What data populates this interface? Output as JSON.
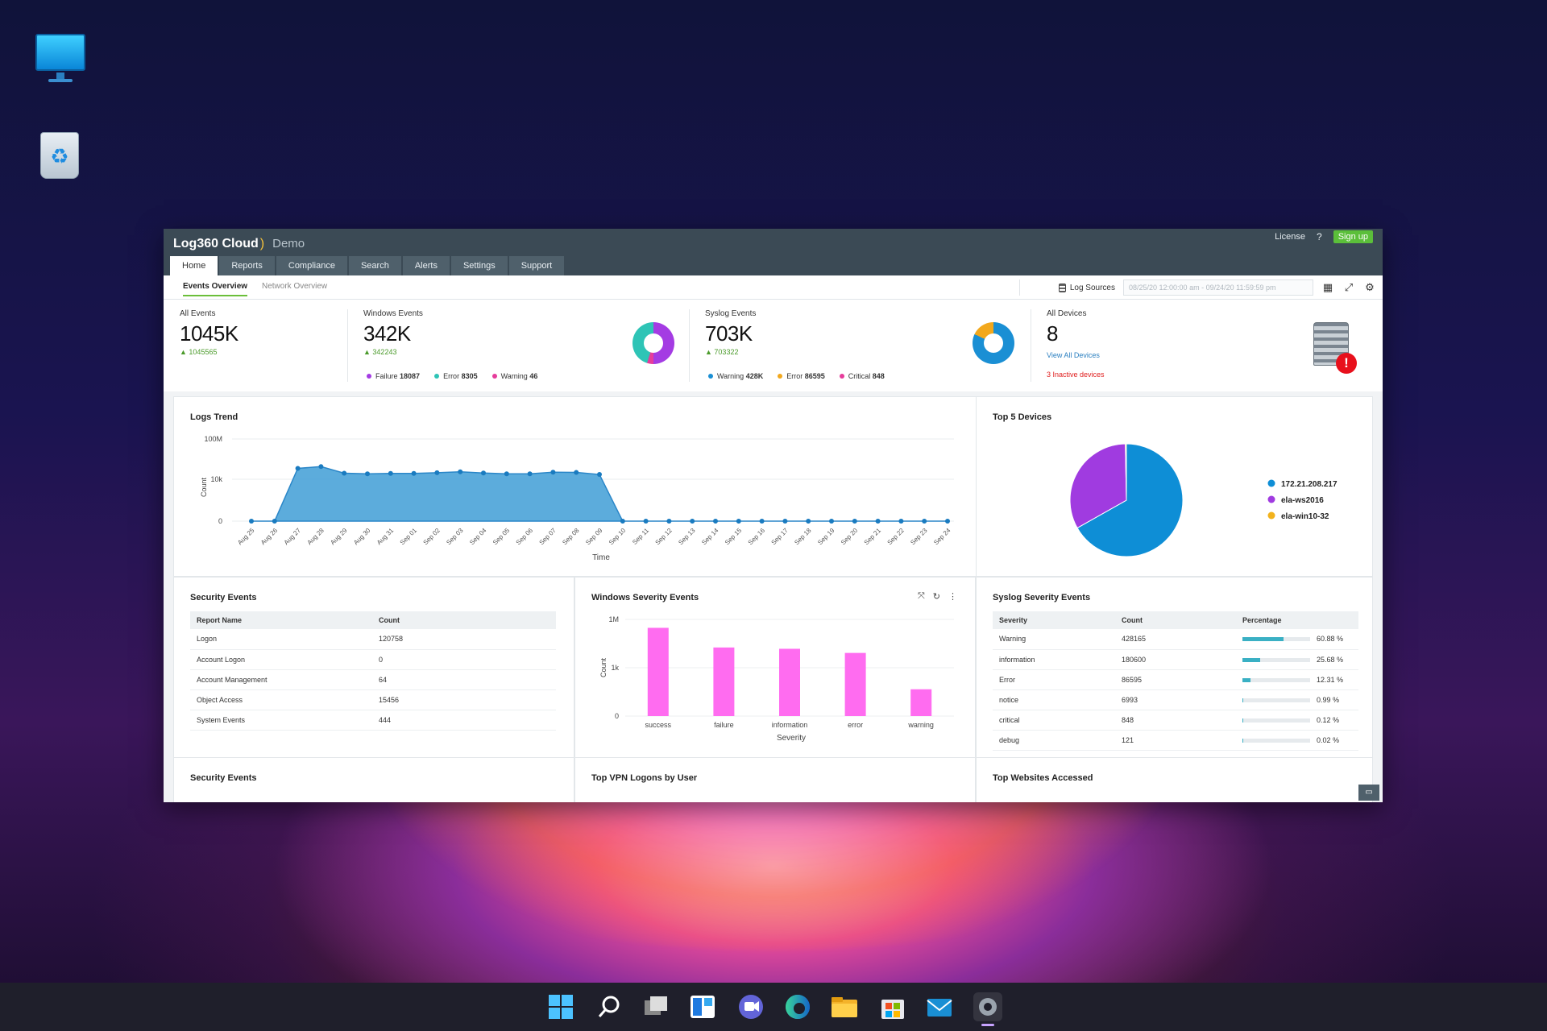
{
  "app": {
    "brand": "Log360 Cloud",
    "moon": ")",
    "edition": "Demo",
    "license_label": "License",
    "help_label": "?",
    "signup_label": "Sign up",
    "tabs": [
      "Home",
      "Reports",
      "Compliance",
      "Search",
      "Alerts",
      "Settings",
      "Support"
    ],
    "subtabs": [
      "Events Overview",
      "Network Overview"
    ],
    "log_sources_label": "Log Sources",
    "date_range": "08/25/20 12:00:00 am - 09/24/20 11:59:59 pm"
  },
  "stats": {
    "all_events": {
      "label": "All Events",
      "value": "1045K",
      "delta": "1045565"
    },
    "windows": {
      "label": "Windows Events",
      "value": "342K",
      "delta": "342243",
      "legend": [
        {
          "name": "Failure",
          "value": "18087",
          "color": "#a43be3"
        },
        {
          "name": "Error",
          "value": "8305",
          "color": "#2ec4b6"
        },
        {
          "name": "Warning",
          "value": "46",
          "color": "#e63c9b"
        }
      ]
    },
    "syslog": {
      "label": "Syslog Events",
      "value": "703K",
      "delta": "703322",
      "legend": [
        {
          "name": "Warning",
          "value": "428K",
          "color": "#1a8fd4"
        },
        {
          "name": "Error",
          "value": "86595",
          "color": "#f2a81d"
        },
        {
          "name": "Critical",
          "value": "848",
          "color": "#e63c9b"
        }
      ]
    },
    "devices": {
      "label": "All Devices",
      "value": "8",
      "link": "View All Devices",
      "inactive": "3 Inactive devices",
      "alert_glyph": "!"
    }
  },
  "panels": {
    "logs_trend": "Logs Trend",
    "top_devices": "Top 5 Devices",
    "security_events": "Security Events",
    "windows_severity": "Windows Severity Events",
    "syslog_severity": "Syslog Severity Events",
    "security_events_2": "Security Events",
    "vpn": "Top VPN Logons by User",
    "websites": "Top Websites Accessed"
  },
  "security_table": {
    "headers": [
      "Report Name",
      "Count"
    ],
    "rows": [
      [
        "Logon",
        "120758"
      ],
      [
        "Account Logon",
        "0"
      ],
      [
        "Account Management",
        "64"
      ],
      [
        "Object Access",
        "15456"
      ],
      [
        "System Events",
        "444"
      ]
    ]
  },
  "syslog_table": {
    "headers": [
      "Severity",
      "Count",
      "Percentage"
    ],
    "rows": [
      {
        "severity": "Warning",
        "count": "428165",
        "pct": "60.88 %",
        "frac": 0.6088
      },
      {
        "severity": "information",
        "count": "180600",
        "pct": "25.68 %",
        "frac": 0.2568
      },
      {
        "severity": "Error",
        "count": "86595",
        "pct": "12.31 %",
        "frac": 0.1231
      },
      {
        "severity": "notice",
        "count": "6993",
        "pct": "0.99 %",
        "frac": 0.0099
      },
      {
        "severity": "critical",
        "count": "848",
        "pct": "0.12 %",
        "frac": 0.0012
      },
      {
        "severity": "debug",
        "count": "121",
        "pct": "0.02 %",
        "frac": 0.0002
      }
    ]
  },
  "chart_data": [
    {
      "type": "area",
      "title": "Logs Trend",
      "xlabel": "Time",
      "ylabel": "Count",
      "y_ticks": [
        "100M",
        "10k",
        "0"
      ],
      "y_scale": "log",
      "categories": [
        "Aug 25",
        "Aug 26",
        "Aug 27",
        "Aug 28",
        "Aug 29",
        "Aug 30",
        "Aug 31",
        "Sep 01",
        "Sep 02",
        "Sep 03",
        "Sep 04",
        "Sep 05",
        "Sep 06",
        "Sep 07",
        "Sep 08",
        "Sep 09",
        "Sep 10",
        "Sep 11",
        "Sep 12",
        "Sep 13",
        "Sep 14",
        "Sep 15",
        "Sep 16",
        "Sep 17",
        "Sep 18",
        "Sep 19",
        "Sep 20",
        "Sep 21",
        "Sep 22",
        "Sep 23",
        "Sep 24"
      ],
      "values": [
        0,
        0,
        120000,
        180000,
        40000,
        35000,
        38000,
        38000,
        45000,
        55000,
        42000,
        35000,
        35000,
        50000,
        48000,
        30000,
        0,
        0,
        0,
        0,
        0,
        0,
        0,
        0,
        0,
        0,
        0,
        0,
        0,
        0,
        0
      ],
      "color": "#4aa3d8"
    },
    {
      "type": "pie",
      "title": "Top 5 Devices",
      "categories": [
        "172.21.208.217",
        "ela-ws2016",
        "ela-win10-32"
      ],
      "values": [
        67,
        33,
        0.3
      ],
      "colors": [
        "#0e8ed6",
        "#a03be0",
        "#f2b21d"
      ]
    },
    {
      "type": "bar",
      "title": "Windows Severity Events",
      "xlabel": "Severity",
      "ylabel": "Count",
      "y_ticks": [
        "1M",
        "1k",
        "0"
      ],
      "y_scale": "log",
      "categories": [
        "success",
        "failure",
        "information",
        "error",
        "warning"
      ],
      "values": [
        300000,
        18087,
        15000,
        8305,
        46
      ],
      "color": "#ff6cf0"
    }
  ],
  "taskbar": {
    "icons": [
      "start-icon",
      "search-icon",
      "task-view-icon",
      "widgets-icon",
      "chat-icon",
      "edge-icon",
      "file-explorer-icon",
      "store-icon",
      "mail-icon",
      "settings-icon"
    ]
  }
}
